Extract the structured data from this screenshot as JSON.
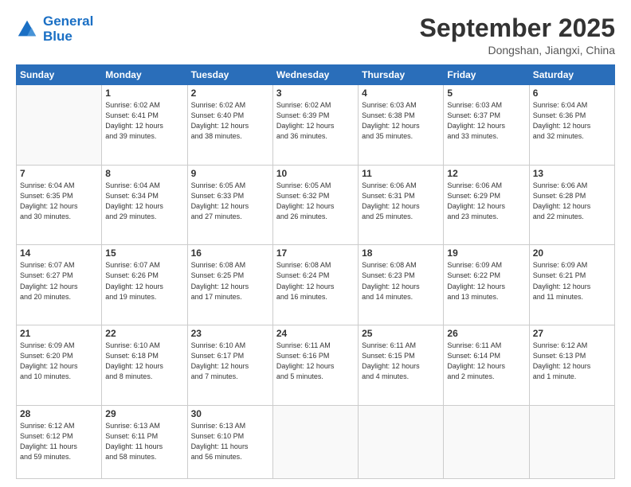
{
  "logo": {
    "line1": "General",
    "line2": "Blue"
  },
  "title": "September 2025",
  "subtitle": "Dongshan, Jiangxi, China",
  "weekdays": [
    "Sunday",
    "Monday",
    "Tuesday",
    "Wednesday",
    "Thursday",
    "Friday",
    "Saturday"
  ],
  "weeks": [
    [
      {
        "day": "",
        "info": ""
      },
      {
        "day": "1",
        "info": "Sunrise: 6:02 AM\nSunset: 6:41 PM\nDaylight: 12 hours\nand 39 minutes."
      },
      {
        "day": "2",
        "info": "Sunrise: 6:02 AM\nSunset: 6:40 PM\nDaylight: 12 hours\nand 38 minutes."
      },
      {
        "day": "3",
        "info": "Sunrise: 6:02 AM\nSunset: 6:39 PM\nDaylight: 12 hours\nand 36 minutes."
      },
      {
        "day": "4",
        "info": "Sunrise: 6:03 AM\nSunset: 6:38 PM\nDaylight: 12 hours\nand 35 minutes."
      },
      {
        "day": "5",
        "info": "Sunrise: 6:03 AM\nSunset: 6:37 PM\nDaylight: 12 hours\nand 33 minutes."
      },
      {
        "day": "6",
        "info": "Sunrise: 6:04 AM\nSunset: 6:36 PM\nDaylight: 12 hours\nand 32 minutes."
      }
    ],
    [
      {
        "day": "7",
        "info": "Sunrise: 6:04 AM\nSunset: 6:35 PM\nDaylight: 12 hours\nand 30 minutes."
      },
      {
        "day": "8",
        "info": "Sunrise: 6:04 AM\nSunset: 6:34 PM\nDaylight: 12 hours\nand 29 minutes."
      },
      {
        "day": "9",
        "info": "Sunrise: 6:05 AM\nSunset: 6:33 PM\nDaylight: 12 hours\nand 27 minutes."
      },
      {
        "day": "10",
        "info": "Sunrise: 6:05 AM\nSunset: 6:32 PM\nDaylight: 12 hours\nand 26 minutes."
      },
      {
        "day": "11",
        "info": "Sunrise: 6:06 AM\nSunset: 6:31 PM\nDaylight: 12 hours\nand 25 minutes."
      },
      {
        "day": "12",
        "info": "Sunrise: 6:06 AM\nSunset: 6:29 PM\nDaylight: 12 hours\nand 23 minutes."
      },
      {
        "day": "13",
        "info": "Sunrise: 6:06 AM\nSunset: 6:28 PM\nDaylight: 12 hours\nand 22 minutes."
      }
    ],
    [
      {
        "day": "14",
        "info": "Sunrise: 6:07 AM\nSunset: 6:27 PM\nDaylight: 12 hours\nand 20 minutes."
      },
      {
        "day": "15",
        "info": "Sunrise: 6:07 AM\nSunset: 6:26 PM\nDaylight: 12 hours\nand 19 minutes."
      },
      {
        "day": "16",
        "info": "Sunrise: 6:08 AM\nSunset: 6:25 PM\nDaylight: 12 hours\nand 17 minutes."
      },
      {
        "day": "17",
        "info": "Sunrise: 6:08 AM\nSunset: 6:24 PM\nDaylight: 12 hours\nand 16 minutes."
      },
      {
        "day": "18",
        "info": "Sunrise: 6:08 AM\nSunset: 6:23 PM\nDaylight: 12 hours\nand 14 minutes."
      },
      {
        "day": "19",
        "info": "Sunrise: 6:09 AM\nSunset: 6:22 PM\nDaylight: 12 hours\nand 13 minutes."
      },
      {
        "day": "20",
        "info": "Sunrise: 6:09 AM\nSunset: 6:21 PM\nDaylight: 12 hours\nand 11 minutes."
      }
    ],
    [
      {
        "day": "21",
        "info": "Sunrise: 6:09 AM\nSunset: 6:20 PM\nDaylight: 12 hours\nand 10 minutes."
      },
      {
        "day": "22",
        "info": "Sunrise: 6:10 AM\nSunset: 6:18 PM\nDaylight: 12 hours\nand 8 minutes."
      },
      {
        "day": "23",
        "info": "Sunrise: 6:10 AM\nSunset: 6:17 PM\nDaylight: 12 hours\nand 7 minutes."
      },
      {
        "day": "24",
        "info": "Sunrise: 6:11 AM\nSunset: 6:16 PM\nDaylight: 12 hours\nand 5 minutes."
      },
      {
        "day": "25",
        "info": "Sunrise: 6:11 AM\nSunset: 6:15 PM\nDaylight: 12 hours\nand 4 minutes."
      },
      {
        "day": "26",
        "info": "Sunrise: 6:11 AM\nSunset: 6:14 PM\nDaylight: 12 hours\nand 2 minutes."
      },
      {
        "day": "27",
        "info": "Sunrise: 6:12 AM\nSunset: 6:13 PM\nDaylight: 12 hours\nand 1 minute."
      }
    ],
    [
      {
        "day": "28",
        "info": "Sunrise: 6:12 AM\nSunset: 6:12 PM\nDaylight: 11 hours\nand 59 minutes."
      },
      {
        "day": "29",
        "info": "Sunrise: 6:13 AM\nSunset: 6:11 PM\nDaylight: 11 hours\nand 58 minutes."
      },
      {
        "day": "30",
        "info": "Sunrise: 6:13 AM\nSunset: 6:10 PM\nDaylight: 11 hours\nand 56 minutes."
      },
      {
        "day": "",
        "info": ""
      },
      {
        "day": "",
        "info": ""
      },
      {
        "day": "",
        "info": ""
      },
      {
        "day": "",
        "info": ""
      }
    ]
  ]
}
